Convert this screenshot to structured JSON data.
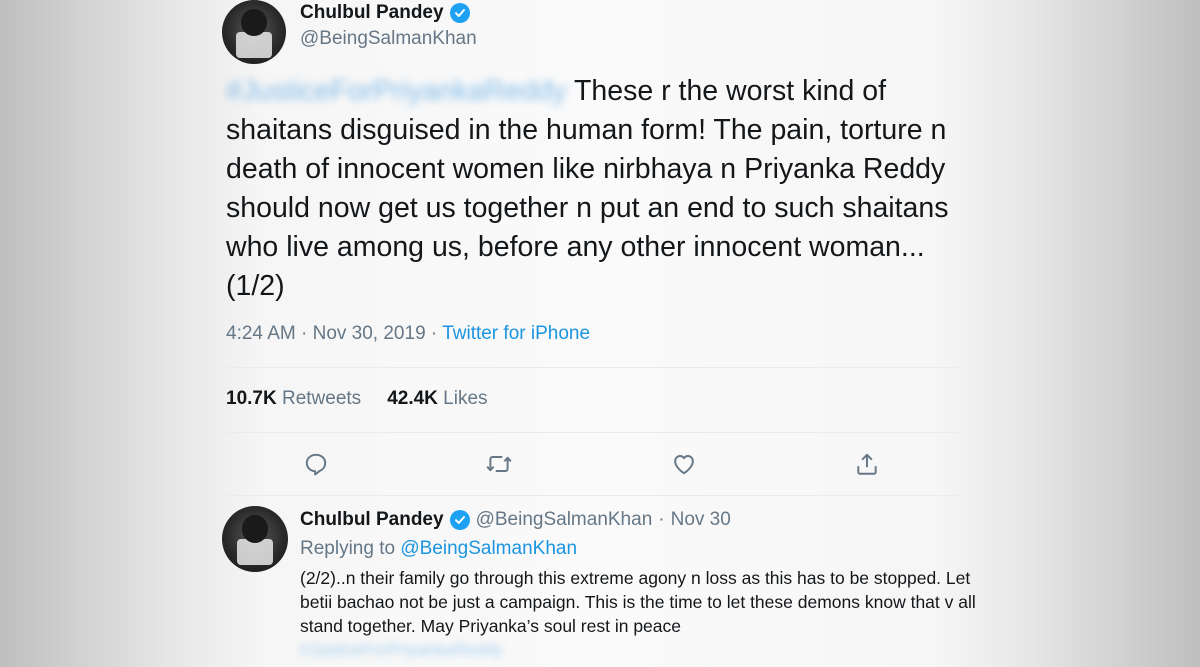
{
  "tweet": {
    "author": {
      "display_name": "Chulbul Pandey",
      "handle": "@BeingSalmanKhan",
      "verified_icon": "verified-badge-icon"
    },
    "hashtag": "#JusticeForPriyankaReddy",
    "text": "These r the worst kind of shaitans disguised in the human form! The pain, torture n death of innocent women like nirbhaya n Priyanka Reddy should now get us together n put an end to such shaitans who live among us, before any other innocent woman...(1/2)",
    "time": "4:24 AM",
    "date": "Nov 30, 2019",
    "source": "Twitter for iPhone",
    "separator": "·",
    "retweets_count": "10.7K",
    "retweets_label": "Retweets",
    "likes_count": "42.4K",
    "likes_label": "Likes",
    "actions": [
      "reply-icon",
      "retweet-icon",
      "like-icon",
      "share-icon"
    ]
  },
  "reply": {
    "author": {
      "display_name": "Chulbul Pandey",
      "handle": "@BeingSalmanKhan"
    },
    "separator": "·",
    "date": "Nov 30",
    "replying_label": "Replying to",
    "replying_to": "@BeingSalmanKhan",
    "text": "(2/2)..n their family go through this extreme agony n loss as this has to be stopped. Let betii bachao not be just a campaign. This is the time to let these demons know that v all stand together. May Priyanka’s soul rest in peace",
    "hashtag": "#JusticeForPriyankaReddy"
  },
  "colors": {
    "link": "#1b95e0",
    "verified": "#1da1f2",
    "text": "#14171a",
    "muted": "#657786"
  }
}
